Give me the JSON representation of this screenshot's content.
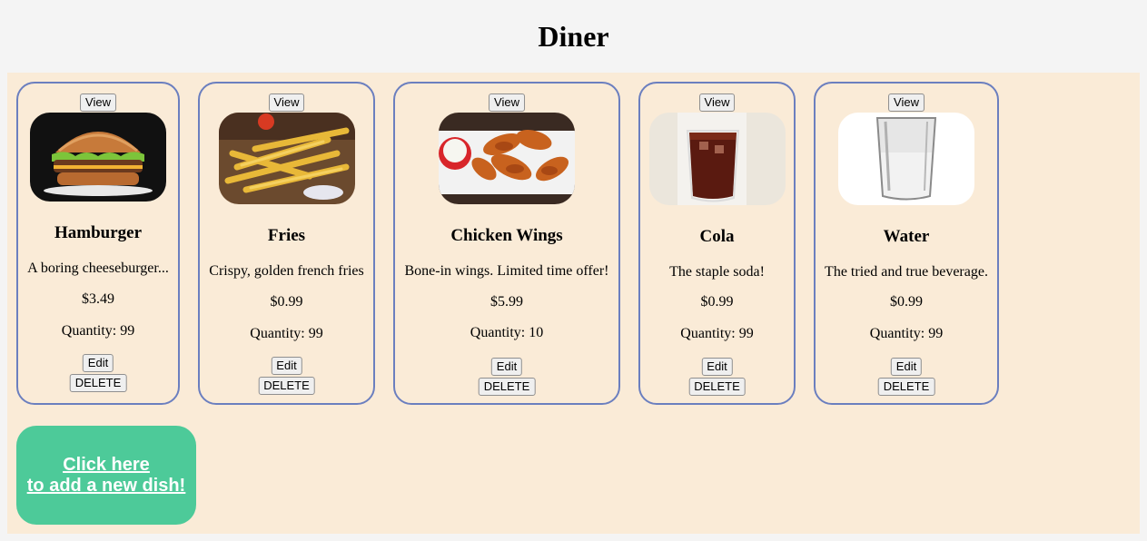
{
  "page_title": "Diner",
  "add_dish": {
    "line1": "Click here",
    "line2": "to add a new dish!"
  },
  "dishes": [
    {
      "view_label": "View",
      "name": "Hamburger",
      "description": "A boring cheeseburger...",
      "price": "$3.49",
      "quantity": "Quantity: 99",
      "edit_label": "Edit",
      "delete_label": "DELETE",
      "image": "hamburger-image"
    },
    {
      "view_label": "View",
      "name": "Fries",
      "description": "Crispy, golden french fries",
      "price": "$0.99",
      "quantity": "Quantity: 99",
      "edit_label": "Edit",
      "delete_label": "DELETE",
      "image": "fries-image"
    },
    {
      "view_label": "View",
      "name": "Chicken Wings",
      "description": "Bone-in wings. Limited time offer!",
      "price": "$5.99",
      "quantity": "Quantity: 10",
      "edit_label": "Edit",
      "delete_label": "DELETE",
      "image": "chicken-wings-image"
    },
    {
      "view_label": "View",
      "name": "Cola",
      "description": "The staple soda!",
      "price": "$0.99",
      "quantity": "Quantity: 99",
      "edit_label": "Edit",
      "delete_label": "DELETE",
      "image": "cola-image"
    },
    {
      "view_label": "View",
      "name": "Water",
      "description": "The tried and true beverage.",
      "price": "$0.99",
      "quantity": "Quantity: 99",
      "edit_label": "Edit",
      "delete_label": "DELETE",
      "image": "water-image"
    }
  ],
  "colors": {
    "page_bg": "#f4f4f4",
    "panel_bg": "#faebd7",
    "card_border": "#6b7fbf",
    "add_button_bg": "#4dca99"
  }
}
